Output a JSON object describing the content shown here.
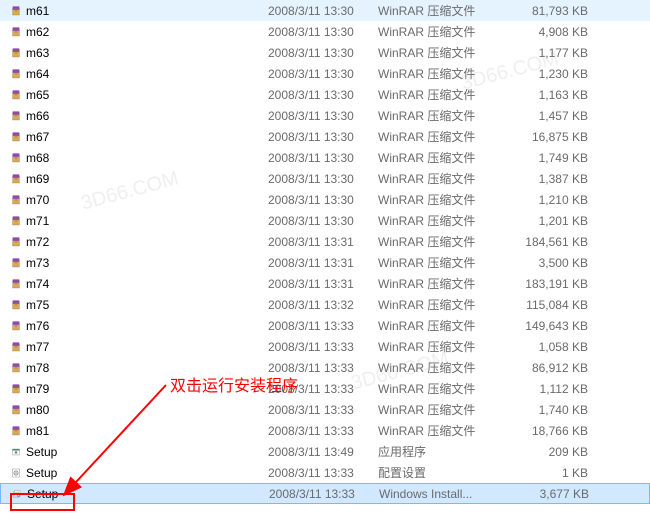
{
  "files": [
    {
      "name": "m61",
      "date": "2008/3/11 13:30",
      "type": "WinRAR 压缩文件",
      "size": "81,793 KB",
      "icon": "rar",
      "state": "highlighted"
    },
    {
      "name": "m62",
      "date": "2008/3/11 13:30",
      "type": "WinRAR 压缩文件",
      "size": "4,908 KB",
      "icon": "rar"
    },
    {
      "name": "m63",
      "date": "2008/3/11 13:30",
      "type": "WinRAR 压缩文件",
      "size": "1,177 KB",
      "icon": "rar"
    },
    {
      "name": "m64",
      "date": "2008/3/11 13:30",
      "type": "WinRAR 压缩文件",
      "size": "1,230 KB",
      "icon": "rar"
    },
    {
      "name": "m65",
      "date": "2008/3/11 13:30",
      "type": "WinRAR 压缩文件",
      "size": "1,163 KB",
      "icon": "rar"
    },
    {
      "name": "m66",
      "date": "2008/3/11 13:30",
      "type": "WinRAR 压缩文件",
      "size": "1,457 KB",
      "icon": "rar"
    },
    {
      "name": "m67",
      "date": "2008/3/11 13:30",
      "type": "WinRAR 压缩文件",
      "size": "16,875 KB",
      "icon": "rar"
    },
    {
      "name": "m68",
      "date": "2008/3/11 13:30",
      "type": "WinRAR 压缩文件",
      "size": "1,749 KB",
      "icon": "rar"
    },
    {
      "name": "m69",
      "date": "2008/3/11 13:30",
      "type": "WinRAR 压缩文件",
      "size": "1,387 KB",
      "icon": "rar"
    },
    {
      "name": "m70",
      "date": "2008/3/11 13:30",
      "type": "WinRAR 压缩文件",
      "size": "1,210 KB",
      "icon": "rar"
    },
    {
      "name": "m71",
      "date": "2008/3/11 13:30",
      "type": "WinRAR 压缩文件",
      "size": "1,201 KB",
      "icon": "rar"
    },
    {
      "name": "m72",
      "date": "2008/3/11 13:31",
      "type": "WinRAR 压缩文件",
      "size": "184,561 KB",
      "icon": "rar"
    },
    {
      "name": "m73",
      "date": "2008/3/11 13:31",
      "type": "WinRAR 压缩文件",
      "size": "3,500 KB",
      "icon": "rar"
    },
    {
      "name": "m74",
      "date": "2008/3/11 13:31",
      "type": "WinRAR 压缩文件",
      "size": "183,191 KB",
      "icon": "rar"
    },
    {
      "name": "m75",
      "date": "2008/3/11 13:32",
      "type": "WinRAR 压缩文件",
      "size": "115,084 KB",
      "icon": "rar"
    },
    {
      "name": "m76",
      "date": "2008/3/11 13:33",
      "type": "WinRAR 压缩文件",
      "size": "149,643 KB",
      "icon": "rar"
    },
    {
      "name": "m77",
      "date": "2008/3/11 13:33",
      "type": "WinRAR 压缩文件",
      "size": "1,058 KB",
      "icon": "rar"
    },
    {
      "name": "m78",
      "date": "2008/3/11 13:33",
      "type": "WinRAR 压缩文件",
      "size": "86,912 KB",
      "icon": "rar"
    },
    {
      "name": "m79",
      "date": "2008/3/11 13:33",
      "type": "WinRAR 压缩文件",
      "size": "1,112 KB",
      "icon": "rar"
    },
    {
      "name": "m80",
      "date": "2008/3/11 13:33",
      "type": "WinRAR 压缩文件",
      "size": "1,740 KB",
      "icon": "rar"
    },
    {
      "name": "m81",
      "date": "2008/3/11 13:33",
      "type": "WinRAR 压缩文件",
      "size": "18,766 KB",
      "icon": "rar"
    },
    {
      "name": "Setup",
      "date": "2008/3/11 13:49",
      "type": "应用程序",
      "size": "209 KB",
      "icon": "exe"
    },
    {
      "name": "Setup",
      "date": "2008/3/11 13:33",
      "type": "配置设置",
      "size": "1 KB",
      "icon": "ini"
    },
    {
      "name": "Setup",
      "date": "2008/3/11 13:33",
      "type": "Windows Install...",
      "size": "3,677 KB",
      "icon": "msi",
      "state": "selected"
    }
  ],
  "annotation": {
    "text": "双击运行安装程序"
  },
  "watermark": "3D66.COM"
}
